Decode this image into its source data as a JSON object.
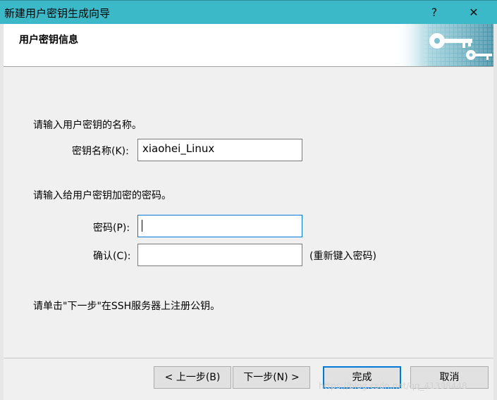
{
  "window": {
    "title": "新建用户密钥生成向导",
    "help_glyph": "?",
    "close_glyph": "✕",
    "titlebar_color": "#3cb9c8"
  },
  "header": {
    "title": "用户密钥信息",
    "art_icon": "keys-icon"
  },
  "form": {
    "name_prompt": "请输入用户密钥的名称。",
    "key_name_label": "密钥名称(K):",
    "key_name_value": "xiaohei_Linux",
    "password_prompt": "请输入给用户密钥加密的密码。",
    "password_label": "密码(P):",
    "password_value": "",
    "confirm_label": "确认(C):",
    "confirm_value": "",
    "confirm_hint": "(重新键入密码)",
    "instruction": "请单击\"下一步\"在SSH服务器上注册公钥。"
  },
  "buttons": {
    "back": "< 上一步(B)",
    "next": "下一步(N) >",
    "finish": "完成",
    "cancel": "取消"
  },
  "watermark": "https://blog.csdn.net/qq_41398448",
  "colors": {
    "accent": "#0078d7"
  }
}
